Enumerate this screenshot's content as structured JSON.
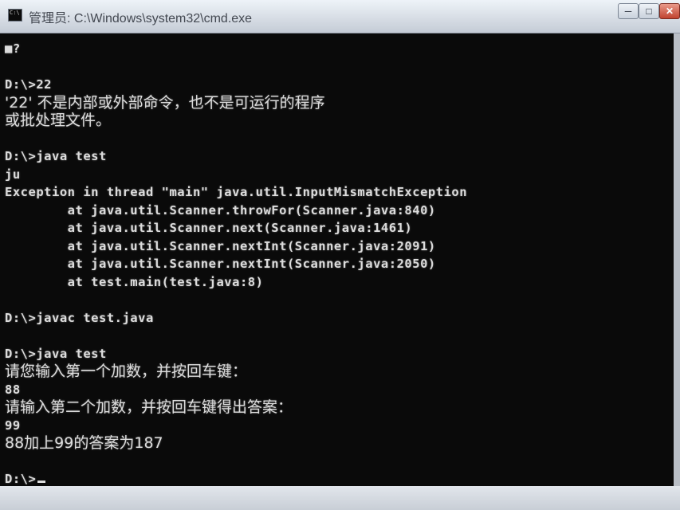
{
  "window": {
    "title": "管理员: C:\\Windows\\system32\\cmd.exe",
    "minimize_glyph": "─",
    "maximize_glyph": "□",
    "close_glyph": "✕"
  },
  "console": {
    "lines": [
      "■?",
      "",
      "D:\\>22",
      "'22' 不是内部或外部命令，也不是可运行的程序",
      "或批处理文件。",
      "",
      "D:\\>java test",
      "ju",
      "Exception in thread \"main\" java.util.InputMismatchException",
      "        at java.util.Scanner.throwFor(Scanner.java:840)",
      "        at java.util.Scanner.next(Scanner.java:1461)",
      "        at java.util.Scanner.nextInt(Scanner.java:2091)",
      "        at java.util.Scanner.nextInt(Scanner.java:2050)",
      "        at test.main(test.java:8)",
      "",
      "D:\\>javac test.java",
      "",
      "D:\\>java test",
      "请您输入第一个加数，并按回车键：",
      "88",
      "请输入第二个加数，并按回车键得出答案：",
      "99",
      "88加上99的答案为187",
      "",
      "D:\\>"
    ]
  }
}
